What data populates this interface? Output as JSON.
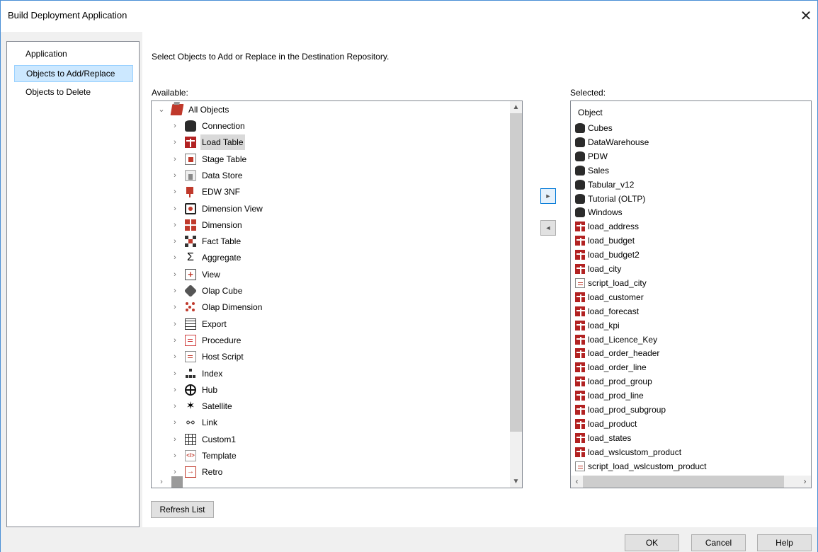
{
  "window": {
    "title": "Build Deployment Application",
    "close_glyph": "✕"
  },
  "nav": {
    "items": [
      {
        "label": "Application",
        "selected": false
      },
      {
        "label": "Objects to Add/Replace",
        "selected": true
      },
      {
        "label": "Objects to Delete",
        "selected": false
      }
    ]
  },
  "main": {
    "instruction": "Select Objects to Add or Replace in the Destination Repository.",
    "available_label": "Available:",
    "selected_label": "Selected:",
    "tree": {
      "root": {
        "label": "All Objects",
        "expanded": true
      },
      "items": [
        {
          "label": "Connection",
          "icon": "connection-icon"
        },
        {
          "label": "Load Table",
          "icon": "load-table-icon",
          "highlighted": true
        },
        {
          "label": "Stage Table",
          "icon": "stage-table-icon"
        },
        {
          "label": "Data Store",
          "icon": "data-store-icon"
        },
        {
          "label": "EDW 3NF",
          "icon": "edw-3nf-icon"
        },
        {
          "label": "Dimension View",
          "icon": "dimension-view-icon"
        },
        {
          "label": "Dimension",
          "icon": "dimension-icon"
        },
        {
          "label": "Fact Table",
          "icon": "fact-table-icon"
        },
        {
          "label": "Aggregate",
          "icon": "aggregate-icon"
        },
        {
          "label": "View",
          "icon": "view-icon"
        },
        {
          "label": "Olap Cube",
          "icon": "olap-cube-icon"
        },
        {
          "label": "Olap Dimension",
          "icon": "olap-dimension-icon"
        },
        {
          "label": "Export",
          "icon": "export-icon"
        },
        {
          "label": "Procedure",
          "icon": "procedure-icon"
        },
        {
          "label": "Host Script",
          "icon": "host-script-icon"
        },
        {
          "label": "Index",
          "icon": "index-icon"
        },
        {
          "label": "Hub",
          "icon": "hub-icon"
        },
        {
          "label": "Satellite",
          "icon": "satellite-icon"
        },
        {
          "label": "Link",
          "icon": "link-icon"
        },
        {
          "label": "Custom1",
          "icon": "custom1-icon"
        },
        {
          "label": "Template",
          "icon": "template-icon"
        },
        {
          "label": "Retro",
          "icon": "retro-icon"
        }
      ]
    },
    "add_button_glyph": "►",
    "remove_button_glyph": "◄",
    "selected_list": {
      "header": "Object",
      "items": [
        {
          "label": "Cubes",
          "type": "connection"
        },
        {
          "label": "DataWarehouse",
          "type": "connection"
        },
        {
          "label": "PDW",
          "type": "connection"
        },
        {
          "label": "Sales",
          "type": "connection"
        },
        {
          "label": "Tabular_v12",
          "type": "connection"
        },
        {
          "label": "Tutorial (OLTP)",
          "type": "connection"
        },
        {
          "label": "Windows",
          "type": "connection"
        },
        {
          "label": "load_address",
          "type": "load-table"
        },
        {
          "label": "load_budget",
          "type": "load-table"
        },
        {
          "label": "load_budget2",
          "type": "load-table"
        },
        {
          "label": "load_city",
          "type": "load-table"
        },
        {
          "label": "script_load_city",
          "type": "script"
        },
        {
          "label": "load_customer",
          "type": "load-table"
        },
        {
          "label": "load_forecast",
          "type": "load-table"
        },
        {
          "label": "load_kpi",
          "type": "load-table"
        },
        {
          "label": "load_Licence_Key",
          "type": "load-table"
        },
        {
          "label": "load_order_header",
          "type": "load-table"
        },
        {
          "label": "load_order_line",
          "type": "load-table"
        },
        {
          "label": "load_prod_group",
          "type": "load-table"
        },
        {
          "label": "load_prod_line",
          "type": "load-table"
        },
        {
          "label": "load_prod_subgroup",
          "type": "load-table"
        },
        {
          "label": "load_product",
          "type": "load-table"
        },
        {
          "label": "load_states",
          "type": "load-table"
        },
        {
          "label": "load_wslcustom_product",
          "type": "load-table"
        },
        {
          "label": "script_load_wslcustom_product",
          "type": "script"
        }
      ]
    },
    "refresh_label": "Refresh List"
  },
  "footer": {
    "ok_label": "OK",
    "cancel_label": "Cancel",
    "help_label": "Help"
  }
}
